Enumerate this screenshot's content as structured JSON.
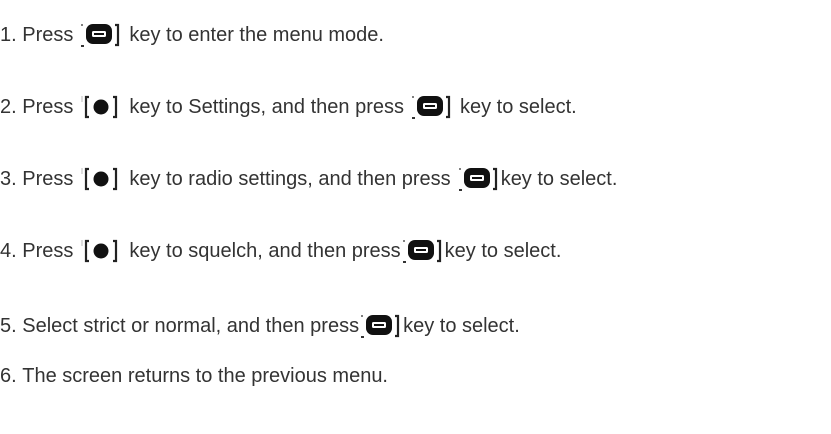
{
  "steps": [
    {
      "number": "1.",
      "parts": [
        "Press",
        "key to enter the menu mode."
      ]
    },
    {
      "number": "2.",
      "parts": [
        "Press",
        "key to Settings, and then press",
        "key to select."
      ]
    },
    {
      "number": "3.",
      "parts": [
        "Press",
        "key to radio settings, and then press",
        "key to select."
      ]
    },
    {
      "number": "4.",
      "parts": [
        "Press",
        "key to squelch, and then press",
        "key to select."
      ]
    },
    {
      "number": "5.",
      "parts": [
        "Select strict or normal, and then press",
        "key to select."
      ]
    },
    {
      "number": "6.",
      "parts": [
        "The screen returns to the previous menu."
      ]
    }
  ],
  "icons": {
    "menu_key": "menu-key-icon",
    "nav_key": "navigation-key-icon"
  }
}
